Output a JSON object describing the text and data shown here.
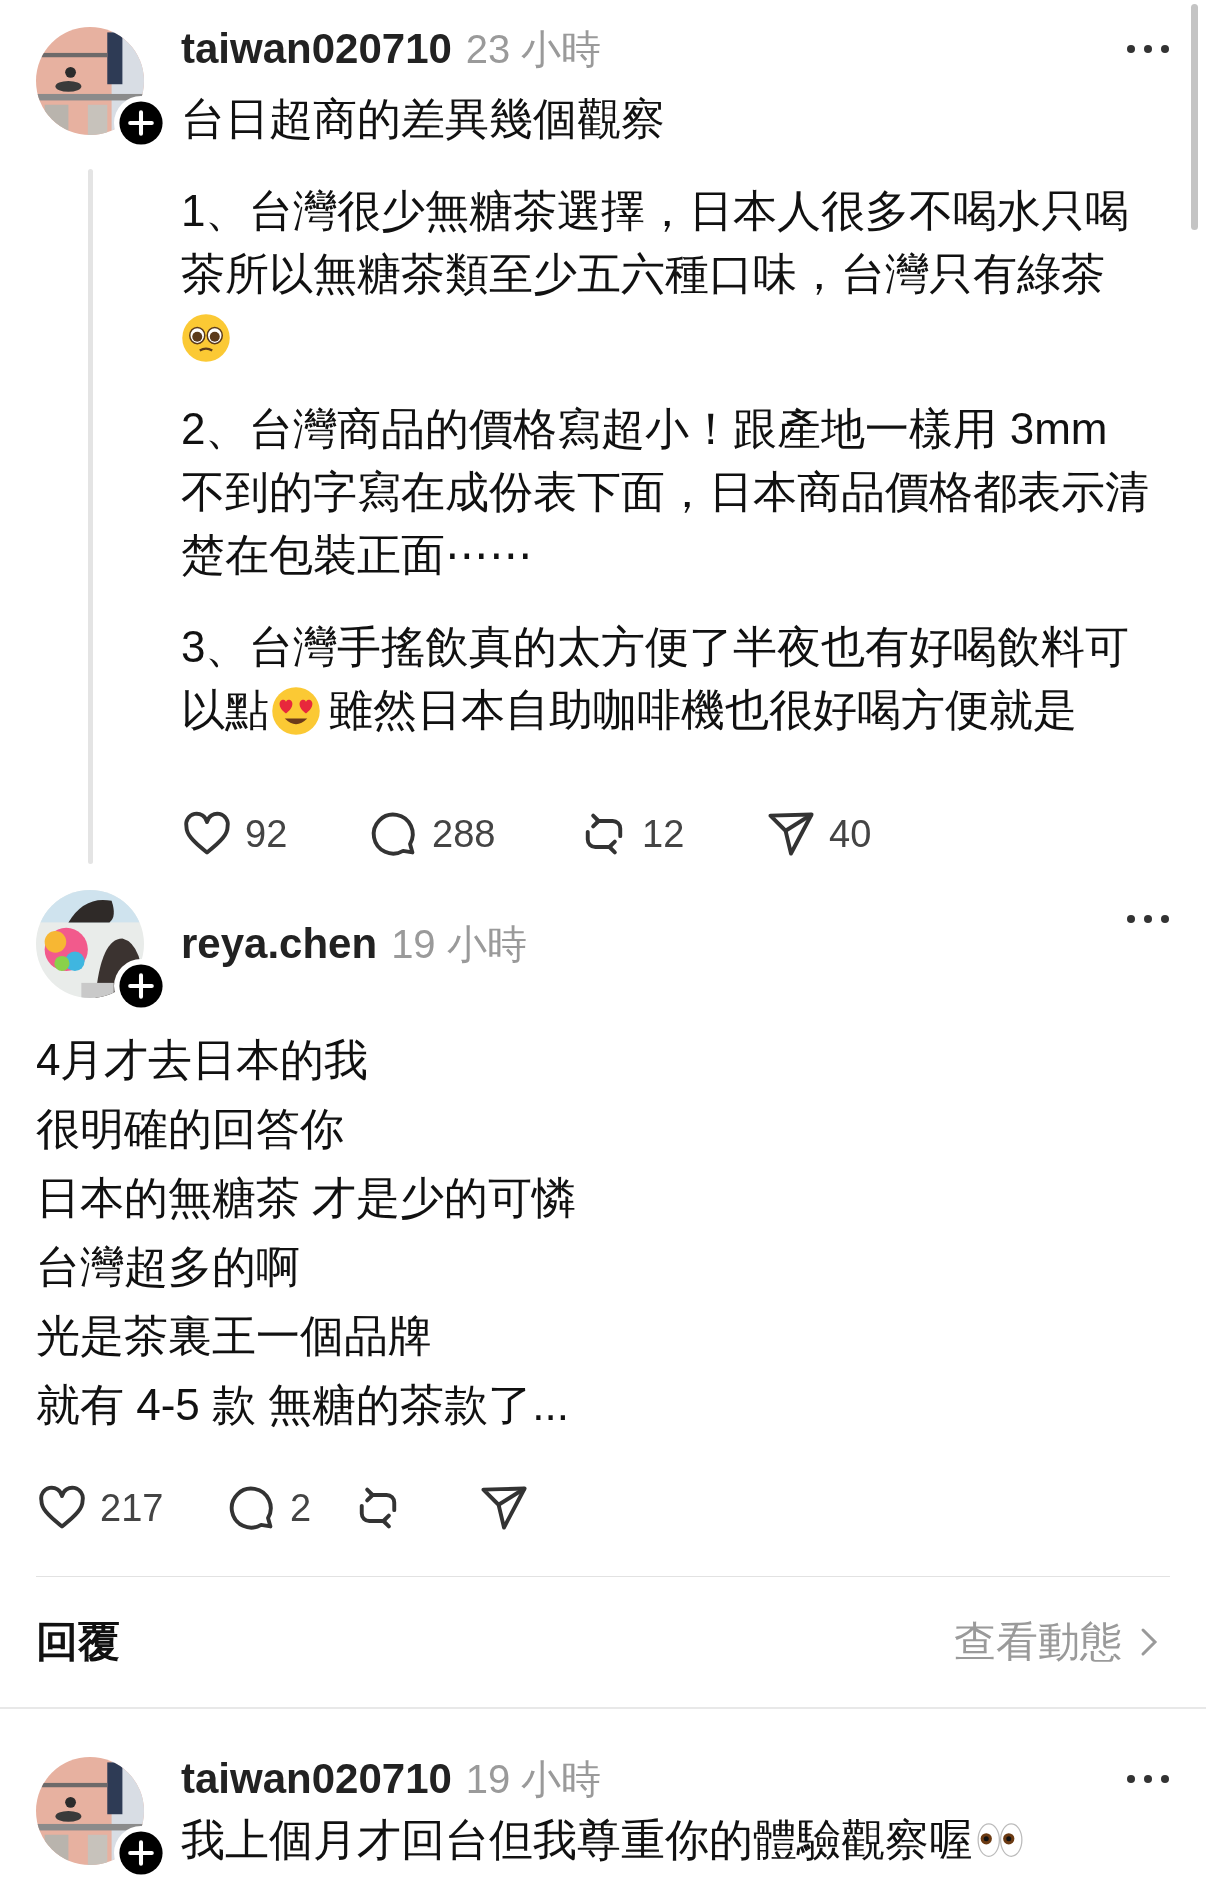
{
  "posts": [
    {
      "kind": "thread",
      "username": "taiwan020710",
      "time": "23 小時",
      "title": [
        {
          "kind": "text",
          "text": "台日超商的差異幾個觀察"
        }
      ],
      "paragraphs": [
        [
          [
            {
              "kind": "text",
              "text": "1、台灣很少無糖茶選擇，日本人很多不喝水只喝"
            }
          ],
          [
            {
              "kind": "text",
              "text": "茶所以無糖茶類至少五六種口味，台灣只有綠茶"
            }
          ],
          [
            {
              "kind": "pleading-face"
            }
          ]
        ],
        [
          [
            {
              "kind": "text",
              "text": "2、台灣商品的價格寫超小！跟產地一樣用 3mm"
            }
          ],
          [
            {
              "kind": "text",
              "text": "不到的字寫在成份表下面，日本商品價格都表示清"
            }
          ],
          [
            {
              "kind": "text",
              "text": "楚在包裝正面⋯⋯"
            }
          ]
        ],
        [
          [
            {
              "kind": "text",
              "text": "3、台灣手搖飲真的太方便了半夜也有好喝飲料可"
            }
          ],
          [
            {
              "kind": "text",
              "text": "以點"
            },
            {
              "kind": "heart-eyes"
            },
            {
              "kind": "text",
              "text": "雖然日本自助咖啡機也很好喝方便就是"
            }
          ]
        ]
      ],
      "actions": [
        {
          "kind": "like",
          "count": "92"
        },
        {
          "kind": "comment",
          "count": "288"
        },
        {
          "kind": "repost",
          "count": "12"
        },
        {
          "kind": "share",
          "count": "40"
        }
      ]
    },
    {
      "kind": "reply",
      "username": "reya.chen",
      "time": "19 小時",
      "paragraphs": [
        [
          [
            {
              "kind": "text",
              "text": "4月才去日本的我"
            }
          ],
          [
            {
              "kind": "text",
              "text": "很明確的回答你"
            }
          ],
          [
            {
              "kind": "text",
              "text": "日本的無糖茶 才是少的可憐"
            }
          ],
          [
            {
              "kind": "text",
              "text": "台灣超多的啊"
            }
          ],
          [
            {
              "kind": "text",
              "text": "光是茶裏王一個品牌"
            }
          ],
          [
            {
              "kind": "text",
              "text": "就有 4-5 款 無糖的茶款了..."
            }
          ]
        ]
      ],
      "actions": [
        {
          "kind": "like",
          "count": "217"
        },
        {
          "kind": "comment",
          "count": "2"
        },
        {
          "kind": "repost"
        },
        {
          "kind": "share"
        }
      ]
    }
  ],
  "reply_bar": {
    "label": "回覆",
    "link": "查看動態"
  },
  "next_post": {
    "username": "taiwan020710",
    "time": "19 小時",
    "title": [
      {
        "kind": "text",
        "text": "我上個月才回台但我尊重你的體驗觀察喔"
      },
      {
        "kind": "eyes"
      }
    ]
  }
}
